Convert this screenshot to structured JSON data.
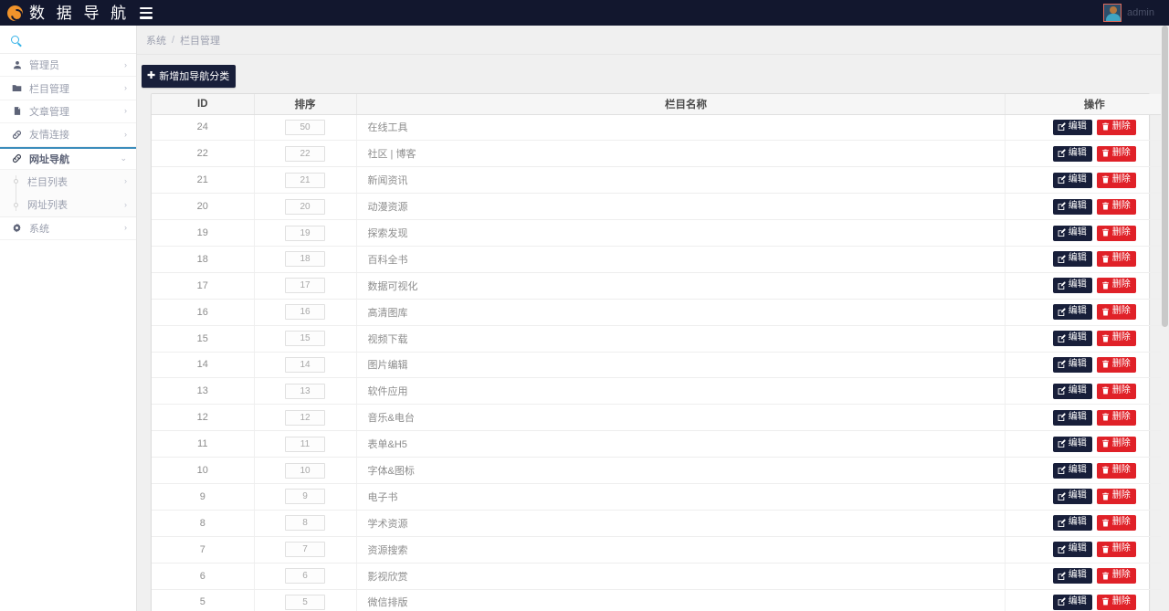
{
  "navbar": {
    "logo_icon": "swirl-logo-icon",
    "brand_title": "数 据 导 航",
    "menu_toggle_icon": "hamburger-icon",
    "username": "admin",
    "avatar_icon": "user-avatar"
  },
  "sidebar": {
    "search": {
      "value": "",
      "placeholder": "",
      "icon": "search-icon"
    },
    "items": [
      {
        "label": "管理员",
        "icon": "user-icon",
        "chevron": "›",
        "active": false
      },
      {
        "label": "栏目管理",
        "icon": "folder-icon",
        "chevron": "›",
        "active": false
      },
      {
        "label": "文章管理",
        "icon": "file-icon",
        "chevron": "›",
        "active": false
      },
      {
        "label": "友情连接",
        "icon": "link-icon",
        "chevron": "›",
        "active": false
      },
      {
        "label": "网址导航",
        "icon": "link-icon",
        "chevron": "⌄",
        "active": true
      },
      {
        "label": "系统",
        "icon": "gear-icon",
        "chevron": "›",
        "active": false
      }
    ],
    "submenu": [
      {
        "label": "栏目列表",
        "chevron": "›"
      },
      {
        "label": "网址列表",
        "chevron": "›"
      }
    ]
  },
  "breadcrumb": {
    "root": "系统",
    "separator": "/",
    "current": "栏目管理"
  },
  "toolbar": {
    "add_label": "新增加导航分类",
    "add_icon": "plus-icon"
  },
  "table": {
    "headers": {
      "id": "ID",
      "sort": "排序",
      "name": "栏目名称",
      "action": "操作"
    },
    "action_labels": {
      "edit": "编辑",
      "delete": "删除"
    },
    "action_icons": {
      "edit": "pencil-square-icon",
      "delete": "trash-icon"
    },
    "rows": [
      {
        "id": "24",
        "sort": "50",
        "name": "在线工具"
      },
      {
        "id": "22",
        "sort": "22",
        "name": "社区 | 博客"
      },
      {
        "id": "21",
        "sort": "21",
        "name": "新闻资讯"
      },
      {
        "id": "20",
        "sort": "20",
        "name": "动漫资源"
      },
      {
        "id": "19",
        "sort": "19",
        "name": "探索发现"
      },
      {
        "id": "18",
        "sort": "18",
        "name": "百科全书"
      },
      {
        "id": "17",
        "sort": "17",
        "name": "数据可视化"
      },
      {
        "id": "16",
        "sort": "16",
        "name": "高清图库"
      },
      {
        "id": "15",
        "sort": "15",
        "name": "视频下载"
      },
      {
        "id": "14",
        "sort": "14",
        "name": "图片编辑"
      },
      {
        "id": "13",
        "sort": "13",
        "name": "软件应用"
      },
      {
        "id": "12",
        "sort": "12",
        "name": "音乐&电台"
      },
      {
        "id": "11",
        "sort": "11",
        "name": "表单&H5"
      },
      {
        "id": "10",
        "sort": "10",
        "name": "字体&图标"
      },
      {
        "id": "9",
        "sort": "9",
        "name": "电子书"
      },
      {
        "id": "8",
        "sort": "8",
        "name": "学术资源"
      },
      {
        "id": "7",
        "sort": "7",
        "name": "资源搜索"
      },
      {
        "id": "6",
        "sort": "6",
        "name": "影视欣赏"
      },
      {
        "id": "5",
        "sort": "5",
        "name": "微信排版"
      }
    ]
  },
  "colors": {
    "navbar_bg": "#12172e",
    "brand_accent": "#f0932b",
    "active_border": "#3c8dbc",
    "edit_btn": "#181f3a",
    "delete_btn": "#e02128"
  }
}
